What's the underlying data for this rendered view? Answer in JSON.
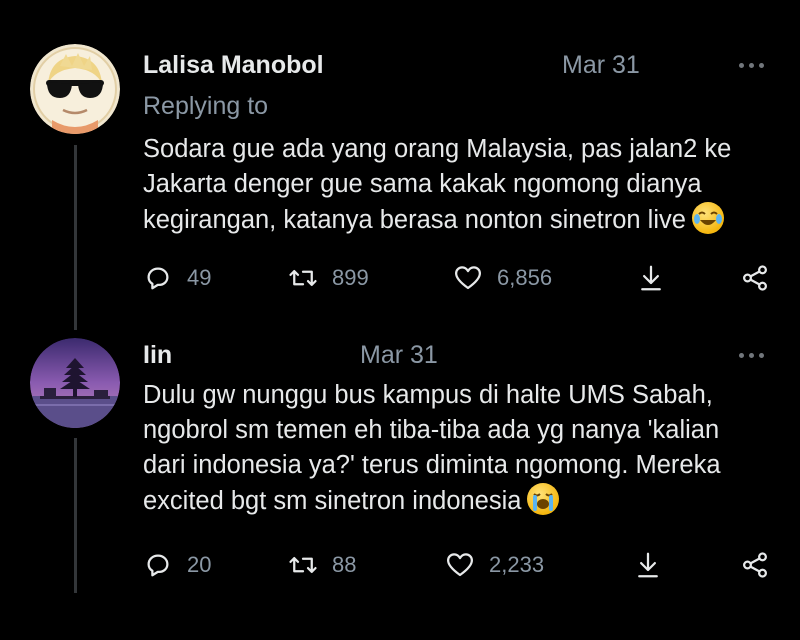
{
  "tweets": [
    {
      "author": "Lalisa Manobol",
      "date": "Mar 31",
      "replying_to": "Replying to",
      "text_lines": [
        "Sodara gue ada yang orang Malaysia, pas jalan2 ke",
        "Jakarta denger gue sama kakak ngomong dianya",
        "kegirangan, katanya berasa nonton sinetron live"
      ],
      "emoji": "laughing-crying-emoji",
      "replies": "49",
      "retweets": "899",
      "likes": "6,856",
      "avatar": "sunglasses-character-avatar"
    },
    {
      "author": "Iin",
      "date": "Mar 31",
      "text_lines": [
        "Dulu gw nunggu bus kampus di halte UMS Sabah,",
        "ngobrol sm temen eh tiba-tiba ada yg nanya 'kalian",
        "dari indonesia ya?' terus diminta ngomong. Mereka",
        "excited bgt sm sinetron indonesia"
      ],
      "emoji": "crying-emoji",
      "replies": "20",
      "retweets": "88",
      "likes": "2,233",
      "avatar": "temple-sunset-avatar"
    }
  ],
  "icons": {
    "reply": "reply-icon",
    "retweet": "retweet-icon",
    "like": "heart-icon",
    "download": "download-icon",
    "share": "share-icon",
    "more": "more-options-icon"
  },
  "colors": {
    "background": "#000000",
    "text": "#e7e9ea",
    "muted": "#8b98a5",
    "thread_line": "#333639"
  }
}
